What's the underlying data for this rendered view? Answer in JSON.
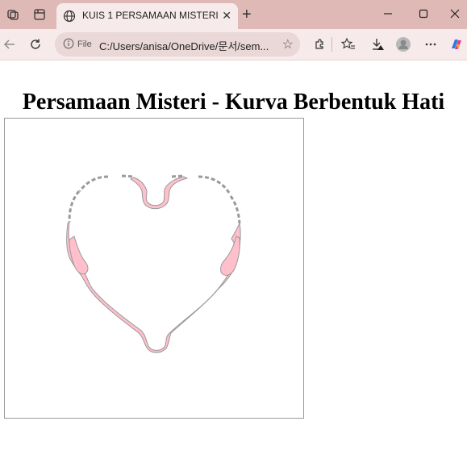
{
  "browser": {
    "tab_title": "KUIS 1 PERSAMAAN MISTERI",
    "address_prefix": "File",
    "url": "C:/Users/anisa/OneDrive/문서/sem..."
  },
  "page": {
    "heading": "Persamaan Misteri - Kurva Berbentuk Hati"
  },
  "colors": {
    "titlebar": "#dfb9b6",
    "toolbar": "#f6eaea",
    "heart_fill": "#ffc0cb",
    "heart_stroke": "#999999"
  },
  "icons": [
    "workspaces-icon",
    "tab-actions-icon",
    "globe-icon",
    "close-icon",
    "plus-icon",
    "minimize-icon",
    "maximize-icon",
    "close-window-icon",
    "back-icon",
    "refresh-icon",
    "info-icon",
    "favorite-icon",
    "extensions-icon",
    "favorites-icon",
    "downloads-icon",
    "profile-icon",
    "more-icon",
    "copilot-icon"
  ]
}
